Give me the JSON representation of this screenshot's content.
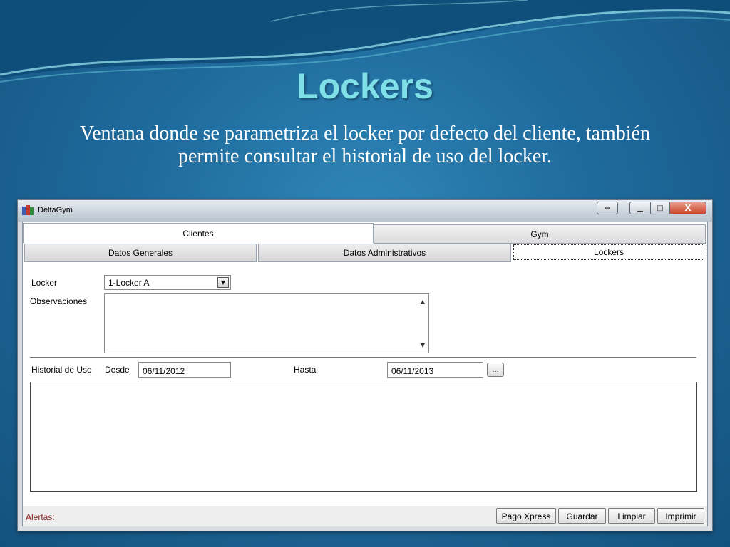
{
  "slide": {
    "title": "Lockers",
    "subtitle": "Ventana donde se parametriza el locker por defecto del cliente, también permite consultar el historial de uso del locker."
  },
  "window": {
    "title": "DeltaGym",
    "close_glyph": "X"
  },
  "tabs": {
    "main": [
      {
        "label": "Clientes",
        "active": true
      },
      {
        "label": "Gym",
        "active": false
      }
    ],
    "sub": [
      {
        "label": "Datos Generales",
        "active": false
      },
      {
        "label": "Datos Administrativos",
        "active": false
      },
      {
        "label": "Lockers",
        "active": true
      }
    ]
  },
  "form": {
    "locker_label": "Locker",
    "locker_value": "1-Locker A",
    "observaciones_label": "Observaciones",
    "observaciones_value": "",
    "historial_label": "Historial de Uso",
    "desde_label": "Desde",
    "desde_value": "06/11/2012",
    "hasta_label": "Hasta",
    "hasta_value": "06/11/2013",
    "ellipsis_label": "..."
  },
  "status": {
    "alerts_label": "Alertas:"
  },
  "buttons": {
    "pago_xpress": "Pago Xpress",
    "guardar": "Guardar",
    "limpiar": "Limpiar",
    "imprimir": "Imprimir"
  },
  "colors": {
    "background": "#1f6a9c",
    "title": "#7fe0e8",
    "alerts": "#8a1c1c",
    "close_button": "#c9432b"
  }
}
